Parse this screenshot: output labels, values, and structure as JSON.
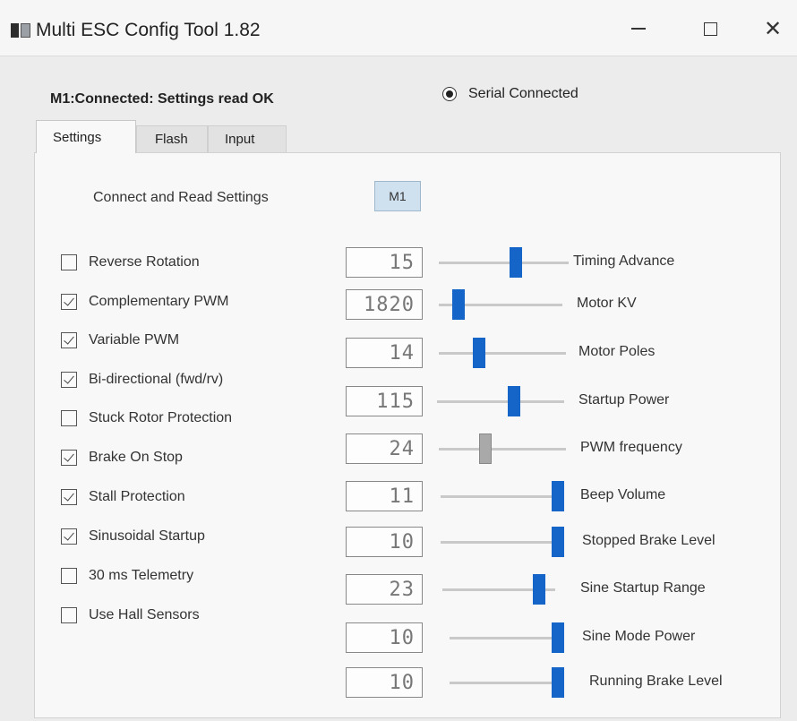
{
  "window": {
    "title": "Multi ESC Config Tool 1.82",
    "close_glyph": "✕"
  },
  "status": {
    "text": "M1:Connected: Settings read OK",
    "serial_label": "Serial Connected",
    "serial_selected": true
  },
  "tabs": [
    {
      "label": "Settings",
      "active": true
    },
    {
      "label": "Flash",
      "active": false
    },
    {
      "label": "Input",
      "active": false
    }
  ],
  "connect": {
    "label": "Connect and Read Settings",
    "button": "M1"
  },
  "options": [
    {
      "label": "Reverse Rotation",
      "checked": false
    },
    {
      "label": "Complementary PWM",
      "checked": true
    },
    {
      "label": "Variable PWM",
      "checked": true
    },
    {
      "label": "Bi-directional (fwd/rv)",
      "checked": true
    },
    {
      "label": "Stuck Rotor Protection",
      "checked": false
    },
    {
      "label": "Brake On Stop",
      "checked": true
    },
    {
      "label": "Stall Protection",
      "checked": true
    },
    {
      "label": "Sinusoidal Startup",
      "checked": true
    },
    {
      "label": "30 ms Telemetry",
      "checked": false
    },
    {
      "label": "Use Hall Sensors",
      "checked": false
    }
  ],
  "sliders": [
    {
      "label": "Timing Advance",
      "value": "15",
      "position": 0.6
    },
    {
      "label": "Motor KV",
      "value": "1820",
      "position": 0.12
    },
    {
      "label": "Motor Poles",
      "value": "14",
      "position": 0.3
    },
    {
      "label": "Startup Power",
      "value": "115",
      "position": 0.62
    },
    {
      "label": "PWM frequency",
      "value": "24",
      "position": 0.35
    },
    {
      "label": "Beep Volume",
      "value": "11",
      "position": 1.0
    },
    {
      "label": "Stopped Brake Level",
      "value": "10",
      "position": 1.0
    },
    {
      "label": "Sine Startup Range",
      "value": "23",
      "position": 0.9
    },
    {
      "label": "Sine Mode Power",
      "value": "10",
      "position": 1.0
    },
    {
      "label": "Running Brake Level",
      "value": "10",
      "position": 1.0
    }
  ],
  "colors": {
    "slider_thumb": "#1565c8",
    "slider_thumb_inactive": "#a9a9a9",
    "m1_button": "#cfe0ef"
  }
}
